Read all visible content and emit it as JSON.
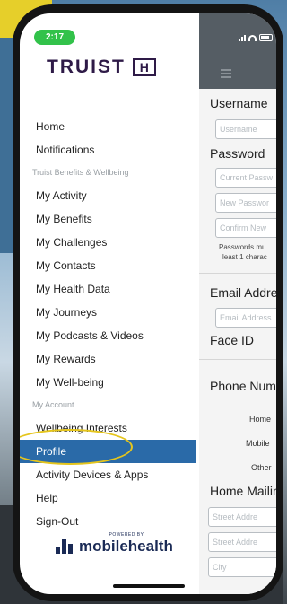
{
  "status": {
    "time": "2:17"
  },
  "brand": {
    "name": "TRUIST",
    "mark": "H"
  },
  "menu": [
    {
      "type": "item",
      "label": "Home"
    },
    {
      "type": "item",
      "label": "Notifications"
    },
    {
      "type": "header",
      "label": "Truist Benefits & Wellbeing"
    },
    {
      "type": "item",
      "label": "My Activity"
    },
    {
      "type": "item",
      "label": "My Benefits"
    },
    {
      "type": "item",
      "label": "My Challenges"
    },
    {
      "type": "item",
      "label": "My Contacts"
    },
    {
      "type": "item",
      "label": "My Health Data"
    },
    {
      "type": "item",
      "label": "My Journeys"
    },
    {
      "type": "item",
      "label": "My Podcasts & Videos"
    },
    {
      "type": "item",
      "label": "My Rewards"
    },
    {
      "type": "item",
      "label": "My Well-being"
    },
    {
      "type": "header",
      "label": "My Account"
    },
    {
      "type": "item",
      "label": "Wellbeing Interests"
    },
    {
      "type": "item",
      "label": "Profile",
      "active": true
    },
    {
      "type": "item",
      "label": "Activity Devices & Apps"
    },
    {
      "type": "item",
      "label": "Help"
    },
    {
      "type": "item",
      "label": "Sign-Out"
    }
  ],
  "powered": {
    "small": "POWERED BY",
    "name": "mobilehealth"
  },
  "form": {
    "username_label": "Username",
    "username_placeholder": "Username",
    "password_label": "Password",
    "current_password_placeholder": "Current Passw",
    "new_password_placeholder": "New Passwor",
    "confirm_password_placeholder": "Confirm New",
    "password_note_1": "Passwords mu",
    "password_note_2": "least 1 charac",
    "email_label": "Email Addre",
    "email_placeholder": "Email Address",
    "faceid_label": "Face ID",
    "phone_label": "Phone Numb",
    "phone_home": "Home",
    "phone_mobile": "Mobile",
    "phone_other": "Other",
    "mailing_label": "Home Mailin",
    "street1_placeholder": "Street Addre",
    "street2_placeholder": "Street Addre",
    "city_placeholder": "City"
  },
  "colors": {
    "accent": "#2a6aa8",
    "brand": "#2e1a47",
    "highlight": "#e5c51c",
    "status_green": "#32c24a"
  }
}
